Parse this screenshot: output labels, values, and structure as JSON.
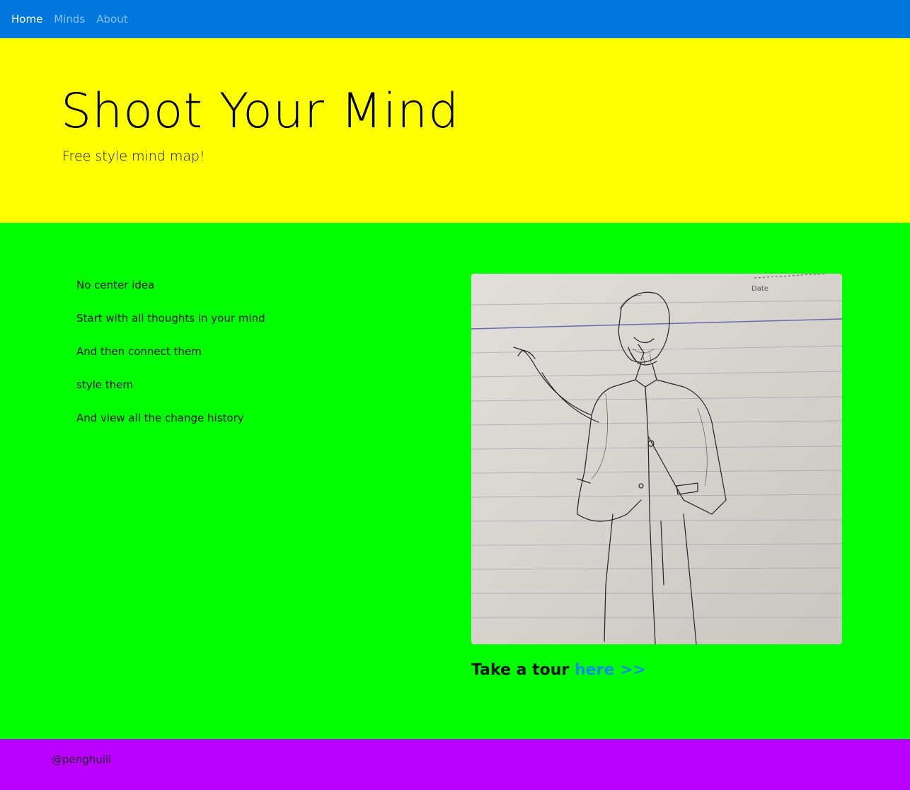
{
  "nav": {
    "items": [
      {
        "label": "Home",
        "active": true
      },
      {
        "label": "Minds",
        "active": false
      },
      {
        "label": "About",
        "active": false
      }
    ],
    "bar_color": "#0077dd"
  },
  "hero": {
    "title": "Shoot Your Mind",
    "subtitle": "Free style mind map!",
    "background": "#ffff00"
  },
  "features": {
    "items": [
      "No center idea",
      "Start with all thoughts in your mind",
      "And then connect them",
      "style them",
      "And view all the change history"
    ],
    "background": "#00ff00"
  },
  "sketch": {
    "paper_label": "Date"
  },
  "tour": {
    "text": "Take a tour",
    "link_label": "here >>"
  },
  "footer": {
    "credit": "@penghuili",
    "background": "#bb00ff"
  }
}
